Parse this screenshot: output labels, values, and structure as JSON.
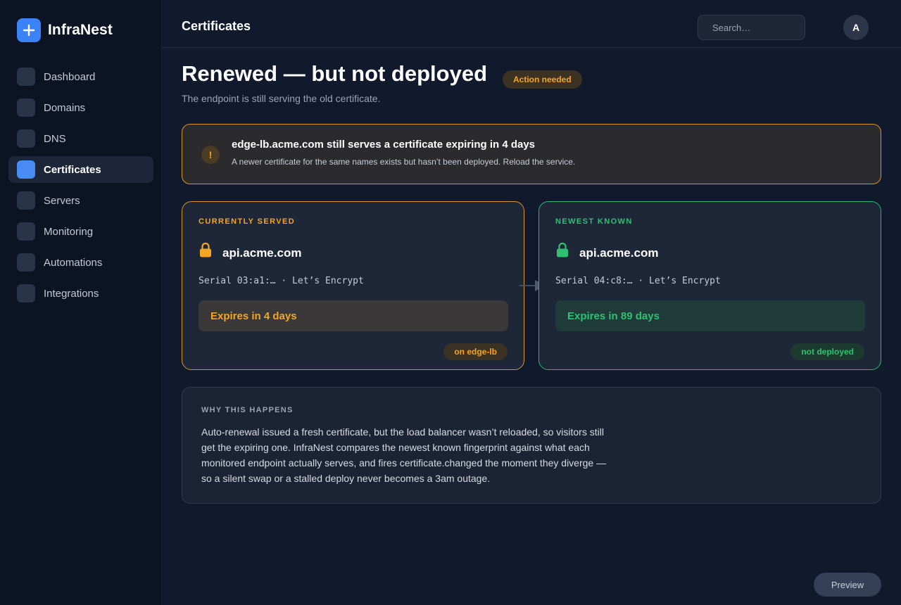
{
  "brand": {
    "name": "InfraNest"
  },
  "sidebar": {
    "items": [
      {
        "label": "Dashboard",
        "active": false
      },
      {
        "label": "Domains",
        "active": false
      },
      {
        "label": "DNS",
        "active": false
      },
      {
        "label": "Certificates",
        "active": true
      },
      {
        "label": "Servers",
        "active": false
      },
      {
        "label": "Monitoring",
        "active": false
      },
      {
        "label": "Automations",
        "active": false
      },
      {
        "label": "Integrations",
        "active": false
      }
    ]
  },
  "header": {
    "title": "Certificates",
    "search_placeholder": "Search…",
    "avatar_initial": "A"
  },
  "page": {
    "title": "Renewed — but not deployed",
    "status_badge": "Action needed",
    "subtitle": "The endpoint is still serving the old certificate."
  },
  "alert": {
    "icon_glyph": "!",
    "title": "edge-lb.acme.com still serves a certificate expiring in 4 days",
    "text": "A newer certificate for the same names exists but hasn’t been deployed. Reload the service."
  },
  "served_card": {
    "eyebrow": "CURRENTLY SERVED",
    "host": "api.acme.com",
    "serial": "Serial 03:a1:… · Let’s Encrypt",
    "expiry": "Expires in 4 days",
    "pill": "on edge-lb",
    "color": "#f5a524"
  },
  "newest_card": {
    "eyebrow": "NEWEST KNOWN",
    "host": "api.acme.com",
    "serial": "Serial 04:c8:… · Let’s Encrypt",
    "expiry": "Expires in 89 days",
    "pill": "not deployed",
    "color": "#2ec16f"
  },
  "why": {
    "title": "WHY THIS HAPPENS",
    "body": "Auto-renewal issued a fresh certificate, but the load balancer wasn’t reloaded, so visitors still get the expiring one. InfraNest compares the newest known fingerprint against what each monitored endpoint actually serves, and fires certificate.changed the moment they diverge — so a silent swap or a stalled deploy never becomes a 3am outage."
  },
  "footer": {
    "preview_label": "Preview"
  },
  "icons": {
    "brand": "plus-icon",
    "alert": "warning-icon",
    "served_lock": "lock-icon",
    "newest_lock": "lock-icon",
    "connector": "arrow-right-icon"
  }
}
